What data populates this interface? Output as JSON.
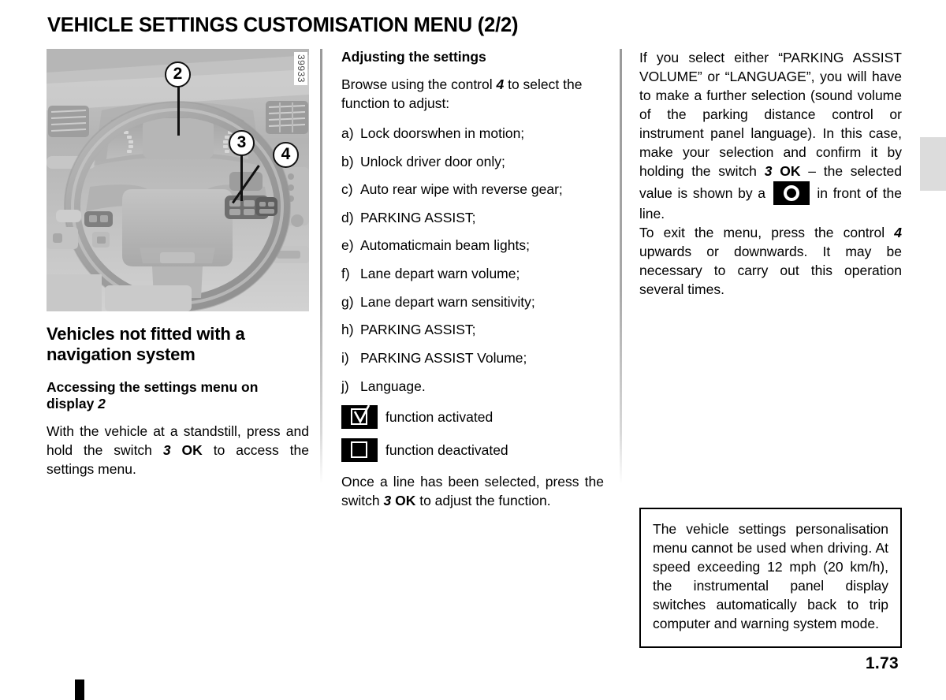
{
  "page": {
    "title": "VEHICLE SETTINGS CUSTOMISATION MENU (2/2)",
    "number": "1.73"
  },
  "figure": {
    "reference_number": "39933",
    "alt": "steering-wheel-and-instrument-panel-photo",
    "callouts": [
      {
        "id": "2",
        "label": "2"
      },
      {
        "id": "3",
        "label": "3"
      },
      {
        "id": "4",
        "label": "4"
      }
    ]
  },
  "column_left": {
    "heading": "Vehicles not fitted with a navigation system",
    "subheading_prefix": "Accessing the settings menu on display ",
    "subheading_italic": "2",
    "paragraph": {
      "part1": "With the vehicle at a standstill, press and hold the switch ",
      "bold_italic": "3",
      "bold": "OK",
      "part2": " to access the settings menu."
    }
  },
  "column_middle": {
    "heading": "Adjusting the settings",
    "intro": {
      "part1": "Browse using the control ",
      "bold_italic": "4",
      "part2": " to select the function to adjust:"
    },
    "list": [
      {
        "mark": "a)",
        "text": "Lock doorswhen in motion;"
      },
      {
        "mark": "b)",
        "text": "Unlock driver door only;"
      },
      {
        "mark": "c)",
        "text": "Auto rear wipe with reverse gear;"
      },
      {
        "mark": "d)",
        "text": "PARKING ASSIST;"
      },
      {
        "mark": "e)",
        "text": "Automaticmain beam lights;"
      },
      {
        "mark": "f)",
        "text": "Lane depart warn volume;"
      },
      {
        "mark": "g)",
        "text": "Lane depart warn sensitivity;"
      },
      {
        "mark": "h)",
        "text": "PARKING ASSIST;"
      },
      {
        "mark": "i)",
        "text": "PARKING ASSIST Volume;"
      },
      {
        "mark": "j)",
        "text": "Language."
      }
    ],
    "legend": [
      {
        "icon": "checkbox-checked-icon",
        "label": "function activated"
      },
      {
        "icon": "checkbox-unchecked-icon",
        "label": "function deactivated"
      }
    ],
    "closing": {
      "part1": "Once a line has been selected, press the switch ",
      "bold_italic": "3",
      "bold": "OK",
      "part2": " to adjust the function."
    }
  },
  "column_right": {
    "paragraph1": {
      "part1": "If you select either “PARKING ASSIST VOLUME” or “LANGUAGE”, you will have to make a further selection (sound volume of the parking distance control or instrument panel language). In this case, make your selection and confirm it by holding the switch ",
      "bold_italic": "3",
      "bold": "OK",
      "part2": " – the selected value is shown by a ",
      "inline_icon": "selected-value-ring-icon",
      "part3": " in front of the line."
    },
    "paragraph2": {
      "part1": "To exit the menu, press the control ",
      "bold_italic": "4",
      "part2": " upwards or downwards. It may be necessary to carry out this operation several times."
    },
    "note": "The vehicle settings personalisation menu cannot be used when driving. At speed exceeding 12 mph (20 km/h), the instrumental panel display switches automatically back to trip computer and warning system mode."
  }
}
